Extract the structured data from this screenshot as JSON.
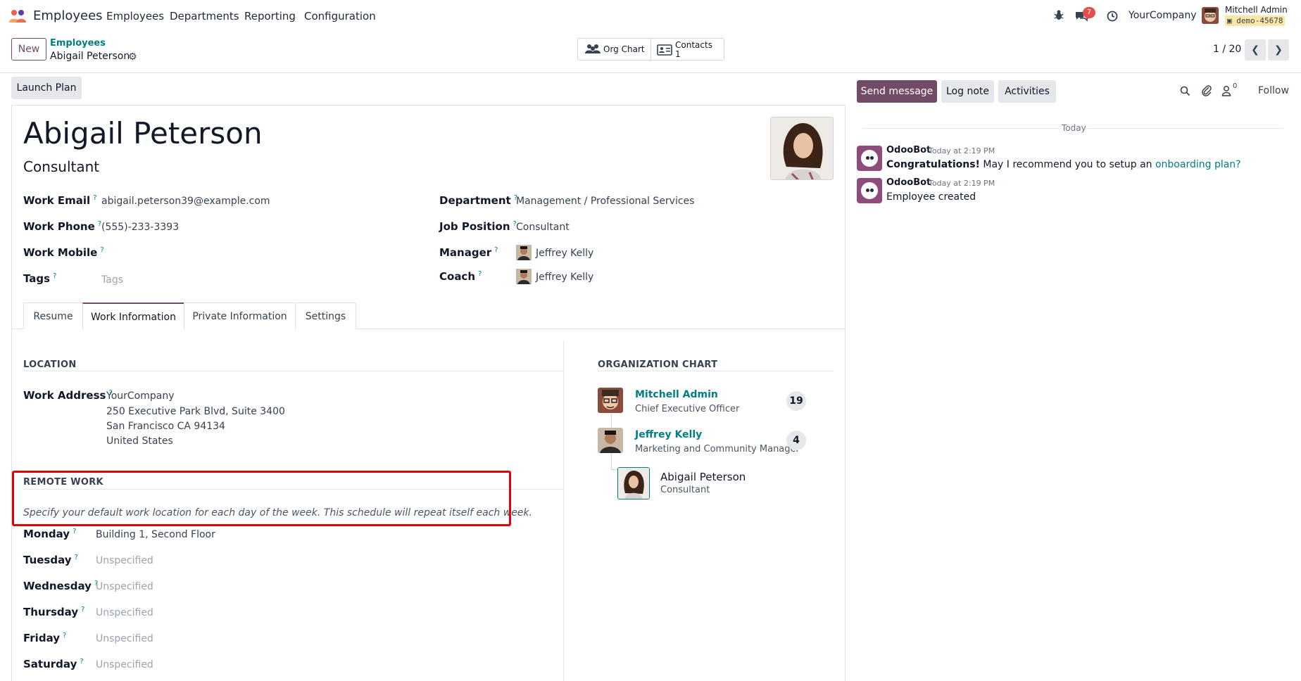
{
  "navbar": {
    "app_name": "Employees",
    "menu": [
      "Employees",
      "Departments",
      "Reporting",
      "Configuration"
    ],
    "message_count": "7",
    "company": "YourCompany",
    "user_name": "Mitchell Admin",
    "database": "demo-45678"
  },
  "control": {
    "new_label": "New",
    "breadcrumb_parent": "Employees",
    "breadcrumb_current": "Abigail Peterson",
    "org_chart_label": "Org Chart",
    "contacts_label": "Contacts",
    "contacts_count": "1",
    "pager": "1 / 20"
  },
  "action": {
    "launch_plan": "Launch Plan"
  },
  "employee": {
    "name": "Abigail Peterson",
    "job_title": "Consultant",
    "fields_left": [
      {
        "label": "Work Email",
        "value": "abigail.peterson39@example.com"
      },
      {
        "label": "Work Phone",
        "value": "(555)-233-3393"
      },
      {
        "label": "Work Mobile",
        "value": ""
      },
      {
        "label": "Tags",
        "value": "",
        "placeholder": "Tags"
      }
    ],
    "fields_right": [
      {
        "label": "Department",
        "value": "Management / Professional Services"
      },
      {
        "label": "Job Position",
        "value": "Consultant"
      },
      {
        "label": "Manager",
        "value": "Jeffrey Kelly"
      },
      {
        "label": "Coach",
        "value": "Jeffrey Kelly"
      }
    ]
  },
  "tabs": [
    "Resume",
    "Work Information",
    "Private Information",
    "Settings"
  ],
  "location": {
    "title": "LOCATION",
    "work_address_label": "Work Address",
    "address_lines": [
      "YourCompany",
      "250 Executive Park Blvd, Suite 3400",
      "San Francisco CA 94134",
      "United States"
    ]
  },
  "remote_work": {
    "title": "REMOTE WORK",
    "hint": "Specify your default work location for each day of the week. This schedule will repeat itself each week.",
    "days": [
      {
        "label": "Monday",
        "value": "Building 1, Second Floor",
        "set": true
      },
      {
        "label": "Tuesday",
        "value": "Unspecified",
        "set": false
      },
      {
        "label": "Wednesday",
        "value": "Unspecified",
        "set": false
      },
      {
        "label": "Thursday",
        "value": "Unspecified",
        "set": false
      },
      {
        "label": "Friday",
        "value": "Unspecified",
        "set": false
      },
      {
        "label": "Saturday",
        "value": "Unspecified",
        "set": false
      }
    ]
  },
  "org_chart": {
    "title": "ORGANIZATION CHART",
    "people": [
      {
        "name": "Mitchell Admin",
        "title": "Chief Executive Officer",
        "count": "19"
      },
      {
        "name": "Jeffrey Kelly",
        "title": "Marketing and Community Manager",
        "count": "4"
      },
      {
        "name": "Abigail Peterson",
        "title": "Consultant"
      }
    ]
  },
  "chatter": {
    "send_message": "Send message",
    "log_note": "Log note",
    "activities": "Activities",
    "followers_count": "0",
    "follow": "Follow",
    "date_separator": "Today",
    "messages": [
      {
        "author": "OdooBot",
        "time": "Today at 2:19 PM",
        "bold": "Congratulations!",
        "text": " May I recommend you to setup an ",
        "link": "onboarding plan?"
      },
      {
        "author": "OdooBot",
        "time": "Today at 2:19 PM",
        "text": "Employee created"
      }
    ]
  },
  "colors": {
    "brand": "#714b67",
    "link": "#017e84",
    "highlight": "#e60000"
  }
}
